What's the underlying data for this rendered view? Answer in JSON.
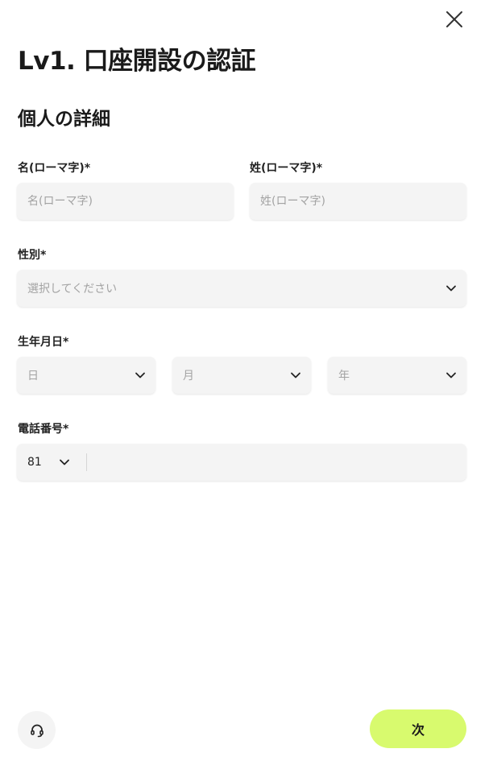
{
  "header": {
    "title": "Lv1. 口座開設の認証",
    "section_title": "個人の詳細"
  },
  "form": {
    "first_name": {
      "label": "名(ローマ字)*",
      "placeholder": "名(ローマ字)",
      "value": ""
    },
    "last_name": {
      "label": "姓(ローマ字)*",
      "placeholder": "姓(ローマ字)",
      "value": ""
    },
    "gender": {
      "label": "性別*",
      "placeholder": "選択してください"
    },
    "birthdate": {
      "label": "生年月日*",
      "day_placeholder": "日",
      "month_placeholder": "月",
      "year_placeholder": "年"
    },
    "phone": {
      "label": "電話番号*",
      "country_code": "81",
      "value": ""
    }
  },
  "footer": {
    "next_label": "次",
    "support_icon": "headset-icon"
  },
  "colors": {
    "accent": "#d8fa6e",
    "field_bg": "#f4f4f4",
    "placeholder": "#a3a3a3"
  }
}
